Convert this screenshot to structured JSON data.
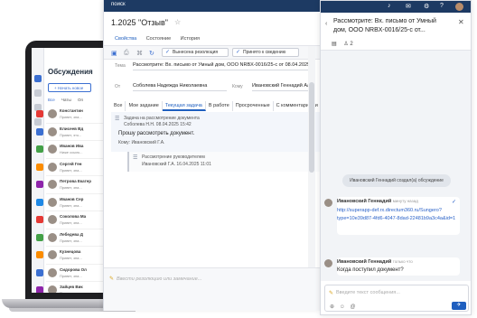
{
  "laptop": {
    "title": "Обсуждения",
    "new_button": "+ Начать новое",
    "tabs": [
      "Все",
      "Чаты",
      "Оп"
    ],
    "items": [
      {
        "name": "Константин",
        "text": "Привет, зна...",
        "badge_color": "#e53935"
      },
      {
        "name": "Елисеев Вд",
        "text": "Привет, это...",
        "badge_color": "#3b6fd1"
      },
      {
        "name": "Иванов Ива",
        "text": "Ниже ссылк...",
        "badge_color": "#43a047"
      },
      {
        "name": "Сергей Ген",
        "text": "Привет, зна...",
        "badge_color": "#fb8c00"
      },
      {
        "name": "Петрова Екатер",
        "text": "Привет, зна...",
        "badge_color": "#8e24aa"
      },
      {
        "name": "Иванов Сер",
        "text": "Привет, зна...",
        "badge_color": "#1e88e5"
      },
      {
        "name": "Соколова Ма",
        "text": "Привет, зна...",
        "badge_color": "#e53935"
      },
      {
        "name": "Лебедева Д",
        "text": "Привет, зна...",
        "badge_color": "#43a047"
      },
      {
        "name": "Кузнецова",
        "text": "Привет, зна...",
        "badge_color": "#fb8c00"
      },
      {
        "name": "Сидорова Ол",
        "text": "Привет, зна...",
        "badge_color": "#3b6fd1"
      },
      {
        "name": "Зайцев Вик",
        "text": "Привет, зна...",
        "badge_color": "#8e24aa"
      }
    ]
  },
  "middle": {
    "topbar_label": "поиск",
    "doc_title": "1.2025 \"Отзыв\"",
    "tabs": [
      "Свойства",
      "Состояние",
      "История"
    ],
    "toolbar": {
      "btn1": "Вынесена резолюция",
      "btn2": "Принято к сведению"
    },
    "fields": {
      "subject_label": "Тема",
      "subject_value": "Рассмотрите: Вх. письмо от Умный дом, ООО NRBX-0016/25-с от 08.04.2025 \"Отзыв\"",
      "from_label": "От",
      "from_value": "Соболева Надежда Николаевна",
      "to_label": "Кому",
      "to_value": "Ивановский Геннадий Алексеевич"
    },
    "filters": [
      "Все",
      "Мое задание",
      "Текущая задача",
      "В работе",
      "Просроченные",
      "С комментариями"
    ],
    "task": {
      "title": "Задача на рассмотрение документа",
      "author_date": "Соболева Н.Н. 08.04.2025 15:42",
      "message": "Прошу рассмотреть документ.",
      "to": "Кому: Ивановский Г.А."
    },
    "subtask": {
      "title": "Рассмотрение руководителем",
      "author_date": "Ивановский Г.А. 16.04.2025 11:01"
    },
    "input_placeholder": "Ввести резолюцию или замечание..."
  },
  "chat": {
    "title": "Рассмотрите: Вх. письмо от Умный дом, ООО NRBX-0016/25-с от...",
    "participants": "2",
    "system_message": "Ивановский Геннадий создал(а) обсуждение",
    "messages": [
      {
        "author": "Ивановский Геннадий",
        "time": "минуту назад",
        "text": "http://superapp-def.rx.directum360.ru/Sungero?type=10e39d87-4fd6-4047-8dad-22481b9a3c4a&id=1"
      },
      {
        "author": "Ивановский Геннадий",
        "time": "только что",
        "text": "Когда поступил документ?"
      }
    ],
    "input_placeholder": "Введите текст сообщения...",
    "send_label": "✈"
  }
}
